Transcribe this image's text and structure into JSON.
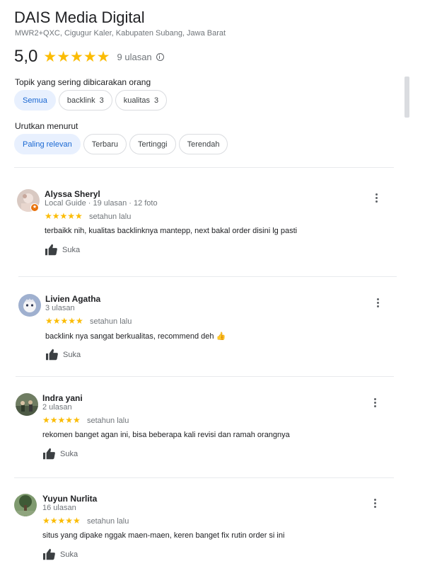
{
  "place": {
    "name": "DAIS Media Digital",
    "address": "MWR2+QXC, Cigugur Kaler, Kabupaten Subang, Jawa Barat",
    "rating": "5,0",
    "stars": "★★★★★",
    "review_count": "9 ulasan"
  },
  "topics": {
    "label": "Topik yang sering dibicarakan orang",
    "chips": [
      {
        "label": "Semua",
        "count": ""
      },
      {
        "label": "backlink",
        "count": "3"
      },
      {
        "label": "kualitas",
        "count": "3"
      }
    ]
  },
  "sort": {
    "label": "Urutkan menurut",
    "chips": [
      {
        "label": "Paling relevan"
      },
      {
        "label": "Terbaru"
      },
      {
        "label": "Tertinggi"
      },
      {
        "label": "Terendah"
      }
    ]
  },
  "reviews": [
    {
      "author": "Alyssa Sheryl",
      "meta": "Local Guide · 19 ulasan · 12 foto",
      "stars": "★★★★★",
      "rating": 5,
      "time": "setahun lalu",
      "text": "terbaikk nih, kualitas backlinknya mantepp, next bakal order disini lg pasti",
      "like": "Suka"
    },
    {
      "author": "Livien Agatha",
      "meta": "3 ulasan",
      "stars": "★★★★★",
      "rating": 5,
      "time": "setahun lalu",
      "text": "backlink nya sangat berkualitas, recommend deh 👍",
      "like": "Suka"
    },
    {
      "author": "Indra yani",
      "meta": "2 ulasan",
      "stars": "★★★★★",
      "rating": 5,
      "time": "setahun lalu",
      "text": "rekomen banget agan ini, bisa beberapa kali revisi dan ramah orangnya",
      "like": "Suka"
    },
    {
      "author": "Yuyun Nurlita",
      "meta": "16 ulasan",
      "stars": "★★★★★",
      "rating": 5,
      "time": "setahun lalu",
      "text": "situs yang dipake nggak maen-maen, keren banget fix rutin order si ini",
      "like": "Suka"
    }
  ],
  "colors": {
    "star": "#fbbc04",
    "active_chip_bg": "#e8f0fe",
    "active_chip_text": "#1967d2",
    "local_guide_badge": "#e8710a"
  }
}
